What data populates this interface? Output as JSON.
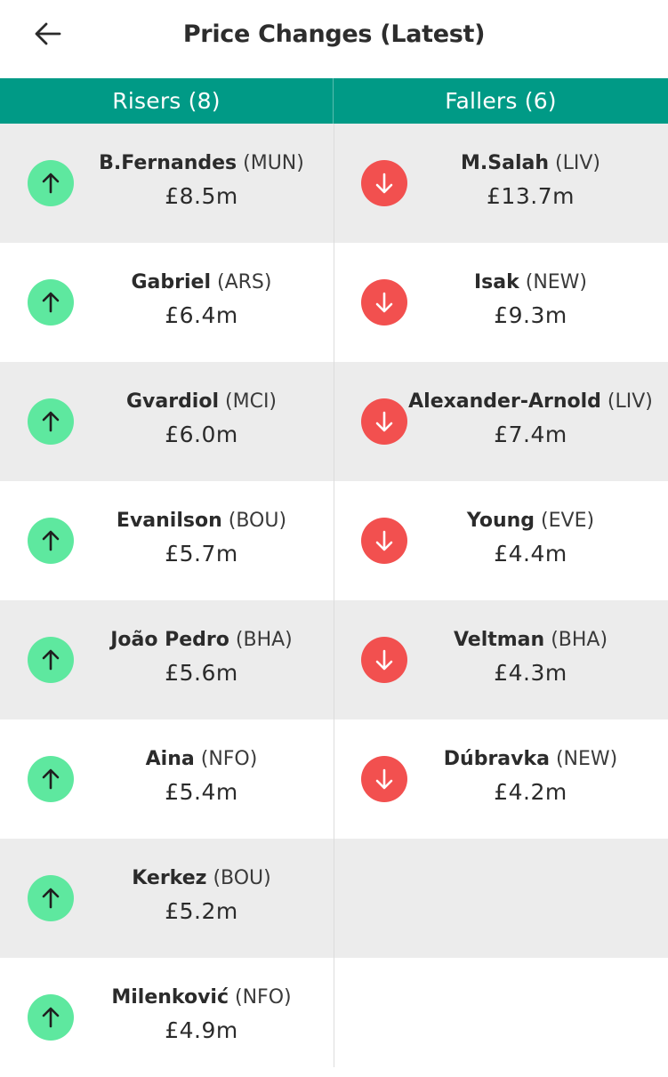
{
  "header": {
    "title": "Price Changes (Latest)"
  },
  "columns": {
    "risers": "Risers (8)",
    "fallers": "Fallers (6)"
  },
  "risers": [
    {
      "name": "B.Fernandes",
      "team": "(MUN)",
      "price": "£8.5m"
    },
    {
      "name": "Gabriel",
      "team": "(ARS)",
      "price": "£6.4m"
    },
    {
      "name": "Gvardiol",
      "team": "(MCI)",
      "price": "£6.0m"
    },
    {
      "name": "Evanilson",
      "team": "(BOU)",
      "price": "£5.7m"
    },
    {
      "name": "João Pedro",
      "team": "(BHA)",
      "price": "£5.6m"
    },
    {
      "name": "Aina",
      "team": "(NFO)",
      "price": "£5.4m"
    },
    {
      "name": "Kerkez",
      "team": "(BOU)",
      "price": "£5.2m"
    },
    {
      "name": "Milenković",
      "team": "(NFO)",
      "price": "£4.9m"
    }
  ],
  "fallers": [
    {
      "name": "M.Salah",
      "team": "(LIV)",
      "price": "£13.7m"
    },
    {
      "name": "Isak",
      "team": "(NEW)",
      "price": "£9.3m"
    },
    {
      "name": "Alexander-Arnold",
      "team": "(LIV)",
      "price": "£7.4m"
    },
    {
      "name": "Young",
      "team": "(EVE)",
      "price": "£4.4m"
    },
    {
      "name": "Veltman",
      "team": "(BHA)",
      "price": "£4.3m"
    },
    {
      "name": "Dúbravka",
      "team": "(NEW)",
      "price": "£4.2m"
    }
  ],
  "icons": {
    "back": "arrow-left-icon",
    "riser": "arrow-up-icon",
    "faller": "arrow-down-icon"
  },
  "colors": {
    "header_bg": "#009a86",
    "riser": "#5ee89f",
    "faller": "#f2504f",
    "row_shade": "#ececec"
  }
}
